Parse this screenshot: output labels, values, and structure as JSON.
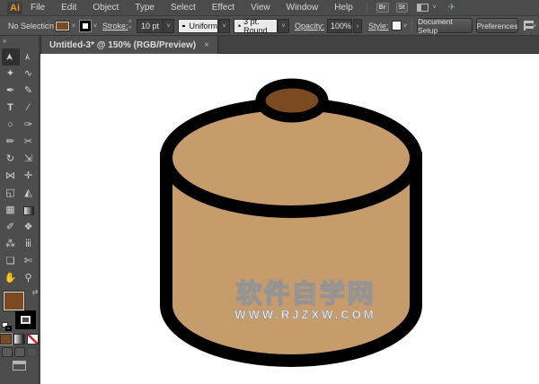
{
  "app": {
    "logo": "Ai",
    "menus": [
      "File",
      "Edit",
      "Object",
      "Type",
      "Select",
      "Effect",
      "View",
      "Window",
      "Help"
    ],
    "bridge_button": "Br",
    "stock_button": "St"
  },
  "control_bar": {
    "selection_status": "No Selection",
    "stroke_label": "Stroke:",
    "stroke_weight": "10 pt",
    "width_profile": "Uniform",
    "brush_bullet": "•",
    "brush_name": "3 pt. Round",
    "opacity_label": "Opacity:",
    "opacity_value": "100%",
    "style_label": "Style:",
    "document_setup_button": "Document Setup",
    "preferences_button": "Preferences"
  },
  "document": {
    "tab_title": "Untitled-3* @ 150% (RGB/Preview)"
  },
  "toolbar": {
    "collapse_glyph": "«",
    "tools": [
      {
        "name": "selection-tool",
        "glyph": "➤"
      },
      {
        "name": "direct-selection-tool",
        "glyph": "➣"
      },
      {
        "name": "magic-wand-tool",
        "glyph": "✦"
      },
      {
        "name": "lasso-tool",
        "glyph": "∿"
      },
      {
        "name": "pen-tool",
        "glyph": "✒"
      },
      {
        "name": "curvature-tool",
        "glyph": "✎"
      },
      {
        "name": "type-tool",
        "glyph": "T"
      },
      {
        "name": "line-segment-tool",
        "glyph": "∕"
      },
      {
        "name": "ellipse-tool",
        "glyph": "○"
      },
      {
        "name": "paintbrush-tool",
        "glyph": "✑"
      },
      {
        "name": "pencil-tool",
        "glyph": "✏"
      },
      {
        "name": "scissors-tool",
        "glyph": "✂"
      },
      {
        "name": "rotate-tool",
        "glyph": "↻"
      },
      {
        "name": "scale-tool",
        "glyph": "⇲"
      },
      {
        "name": "width-tool",
        "glyph": "⋈"
      },
      {
        "name": "puppet-warp-tool",
        "glyph": "✛"
      },
      {
        "name": "shape-builder-tool",
        "glyph": "◱"
      },
      {
        "name": "perspective-grid-tool",
        "glyph": "◭"
      },
      {
        "name": "mesh-tool",
        "glyph": "▦"
      },
      {
        "name": "gradient-tool",
        "glyph": "▤"
      },
      {
        "name": "eyedropper-tool",
        "glyph": "✐"
      },
      {
        "name": "blend-tool",
        "glyph": "❖"
      },
      {
        "name": "symbol-sprayer-tool",
        "glyph": "⁂"
      },
      {
        "name": "column-graph-tool",
        "glyph": "ⅲ"
      },
      {
        "name": "artboard-tool",
        "glyph": "❏"
      },
      {
        "name": "slice-tool",
        "glyph": "✄"
      },
      {
        "name": "hand-tool",
        "glyph": "✋"
      },
      {
        "name": "zoom-tool",
        "glyph": "⚲"
      }
    ]
  },
  "icons": {
    "chevron_down": "˅",
    "stepper_up": "˄",
    "stepper_down": "˅",
    "close": "×",
    "swap": "⇄",
    "opacity_more": "›",
    "share": "✈"
  },
  "canvas": {
    "watermark_title": "软件自学网",
    "watermark_url": "WWW.RJZXW.COM"
  },
  "colors": {
    "accent_logo": "#f7941e",
    "pot_body": "#c69c6d",
    "pot_knob": "#7b4a21",
    "outline": "#000000",
    "current_fill_swatch": "#7b4a21",
    "watermark": "#ffffff"
  }
}
